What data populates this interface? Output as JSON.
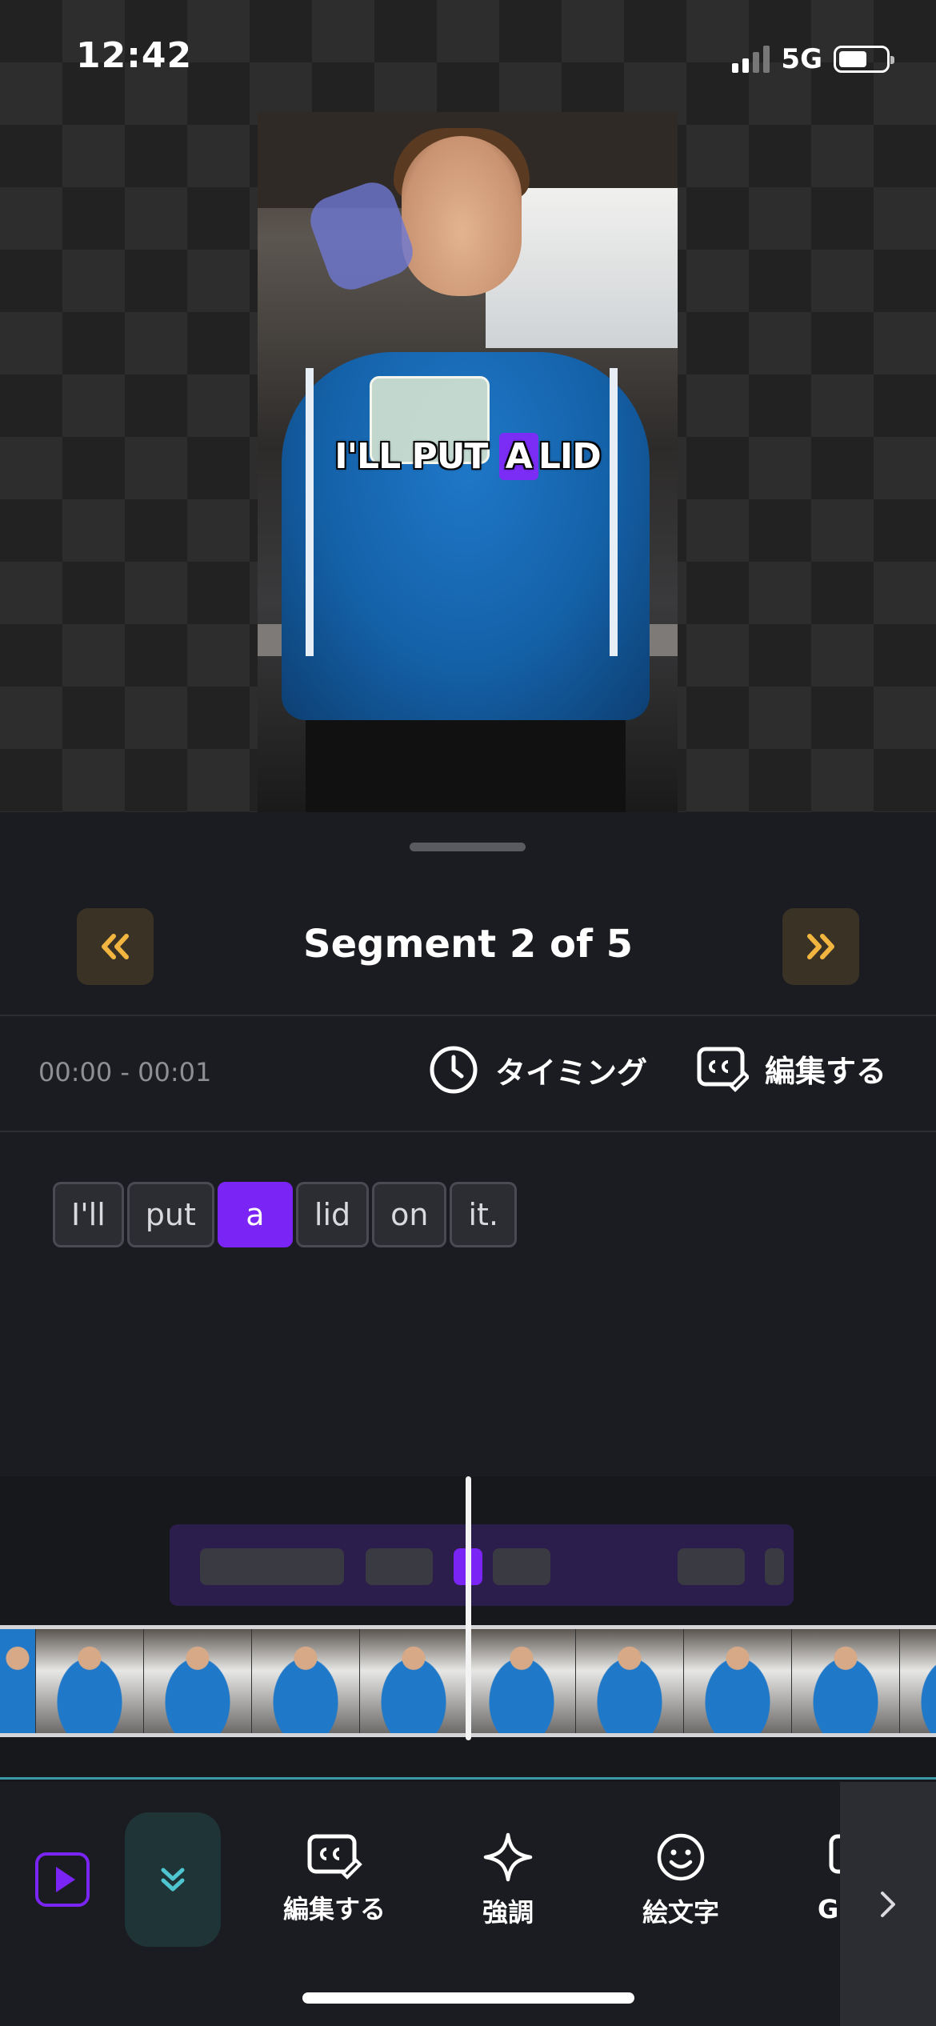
{
  "status_bar": {
    "time": "12:42",
    "network": "5G"
  },
  "video_caption": {
    "pre": "I'LL PUT",
    "highlight": "A",
    "post": "LID"
  },
  "segment_nav": {
    "prev_icon": "double-chevron-left-icon",
    "title": "Segment 2 of 5",
    "next_icon": "double-chevron-right-icon",
    "accent_color": "#f2b540"
  },
  "segment_info": {
    "time_range": "00:00 - 00:01",
    "timing_label": "タイミング",
    "edit_label": "編集する"
  },
  "words": [
    {
      "text": "I'll",
      "active": false
    },
    {
      "text": "put",
      "active": false
    },
    {
      "text": "a",
      "active": true
    },
    {
      "text": "lid",
      "active": false
    },
    {
      "text": "on",
      "active": false
    },
    {
      "text": "it.",
      "active": false
    }
  ],
  "highlight_color": "#7a24f5",
  "toolbar": {
    "play_icon": "play-icon",
    "collapse_icon": "double-chevron-down-icon",
    "edit_label": "編集する",
    "emphasis_label": "強調",
    "emoji_label": "絵文字",
    "more_label": "G",
    "scroll_icon": "chevron-right-icon"
  }
}
